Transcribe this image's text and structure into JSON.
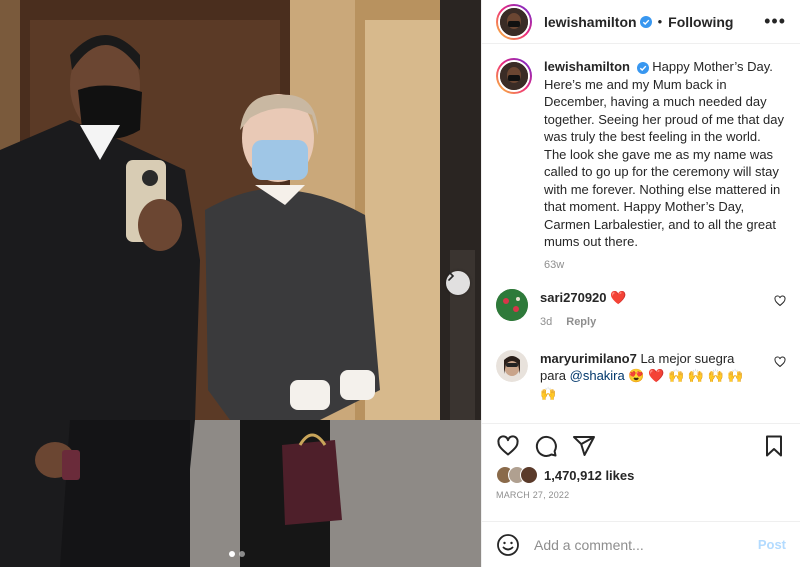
{
  "post": {
    "username": "lewishamilton",
    "follow_status": "Following",
    "more_icon": "more-options-icon",
    "photo_alt": "",
    "carousel": {
      "total": 2,
      "current": 1
    }
  },
  "caption": {
    "username": "lewishamilton",
    "text": "Happy Mother’s Day. Here’s me and my Mum back in December, having a much needed day together. Seeing her proud of me that day was truly the best feeling in the world. The look she gave me as my name was called to go up for the ceremony will stay with me forever. Nothing else mattered in that moment. Happy Mother’s Day, Carmen Larbalestier, and to all the great mums out there.",
    "age": "63w"
  },
  "comments": [
    {
      "username": "sari270920",
      "text": "❤️",
      "age": "3d",
      "reply": "Reply"
    },
    {
      "username": "maryurimilano7",
      "text_before": "La mejor suegra para ",
      "mention": "@shakira",
      "text_after": " 😍 ❤️ 🙌 🙌 🙌 🙌 🙌"
    }
  ],
  "actions": {
    "like_icon": "heart-icon",
    "comment_icon": "comment-icon",
    "share_icon": "share-icon",
    "save_icon": "bookmark-icon"
  },
  "likes": {
    "count": "1,470,912 likes"
  },
  "date": "MARCH 27, 2022",
  "add_comment": {
    "placeholder": "Add a comment...",
    "post_label": "Post",
    "emoji_icon": "emoji-icon"
  },
  "colors": {
    "verified": "#3897f0",
    "link": "#00376b",
    "post_disabled": "#b3dbff",
    "heart": "#ed4956"
  }
}
